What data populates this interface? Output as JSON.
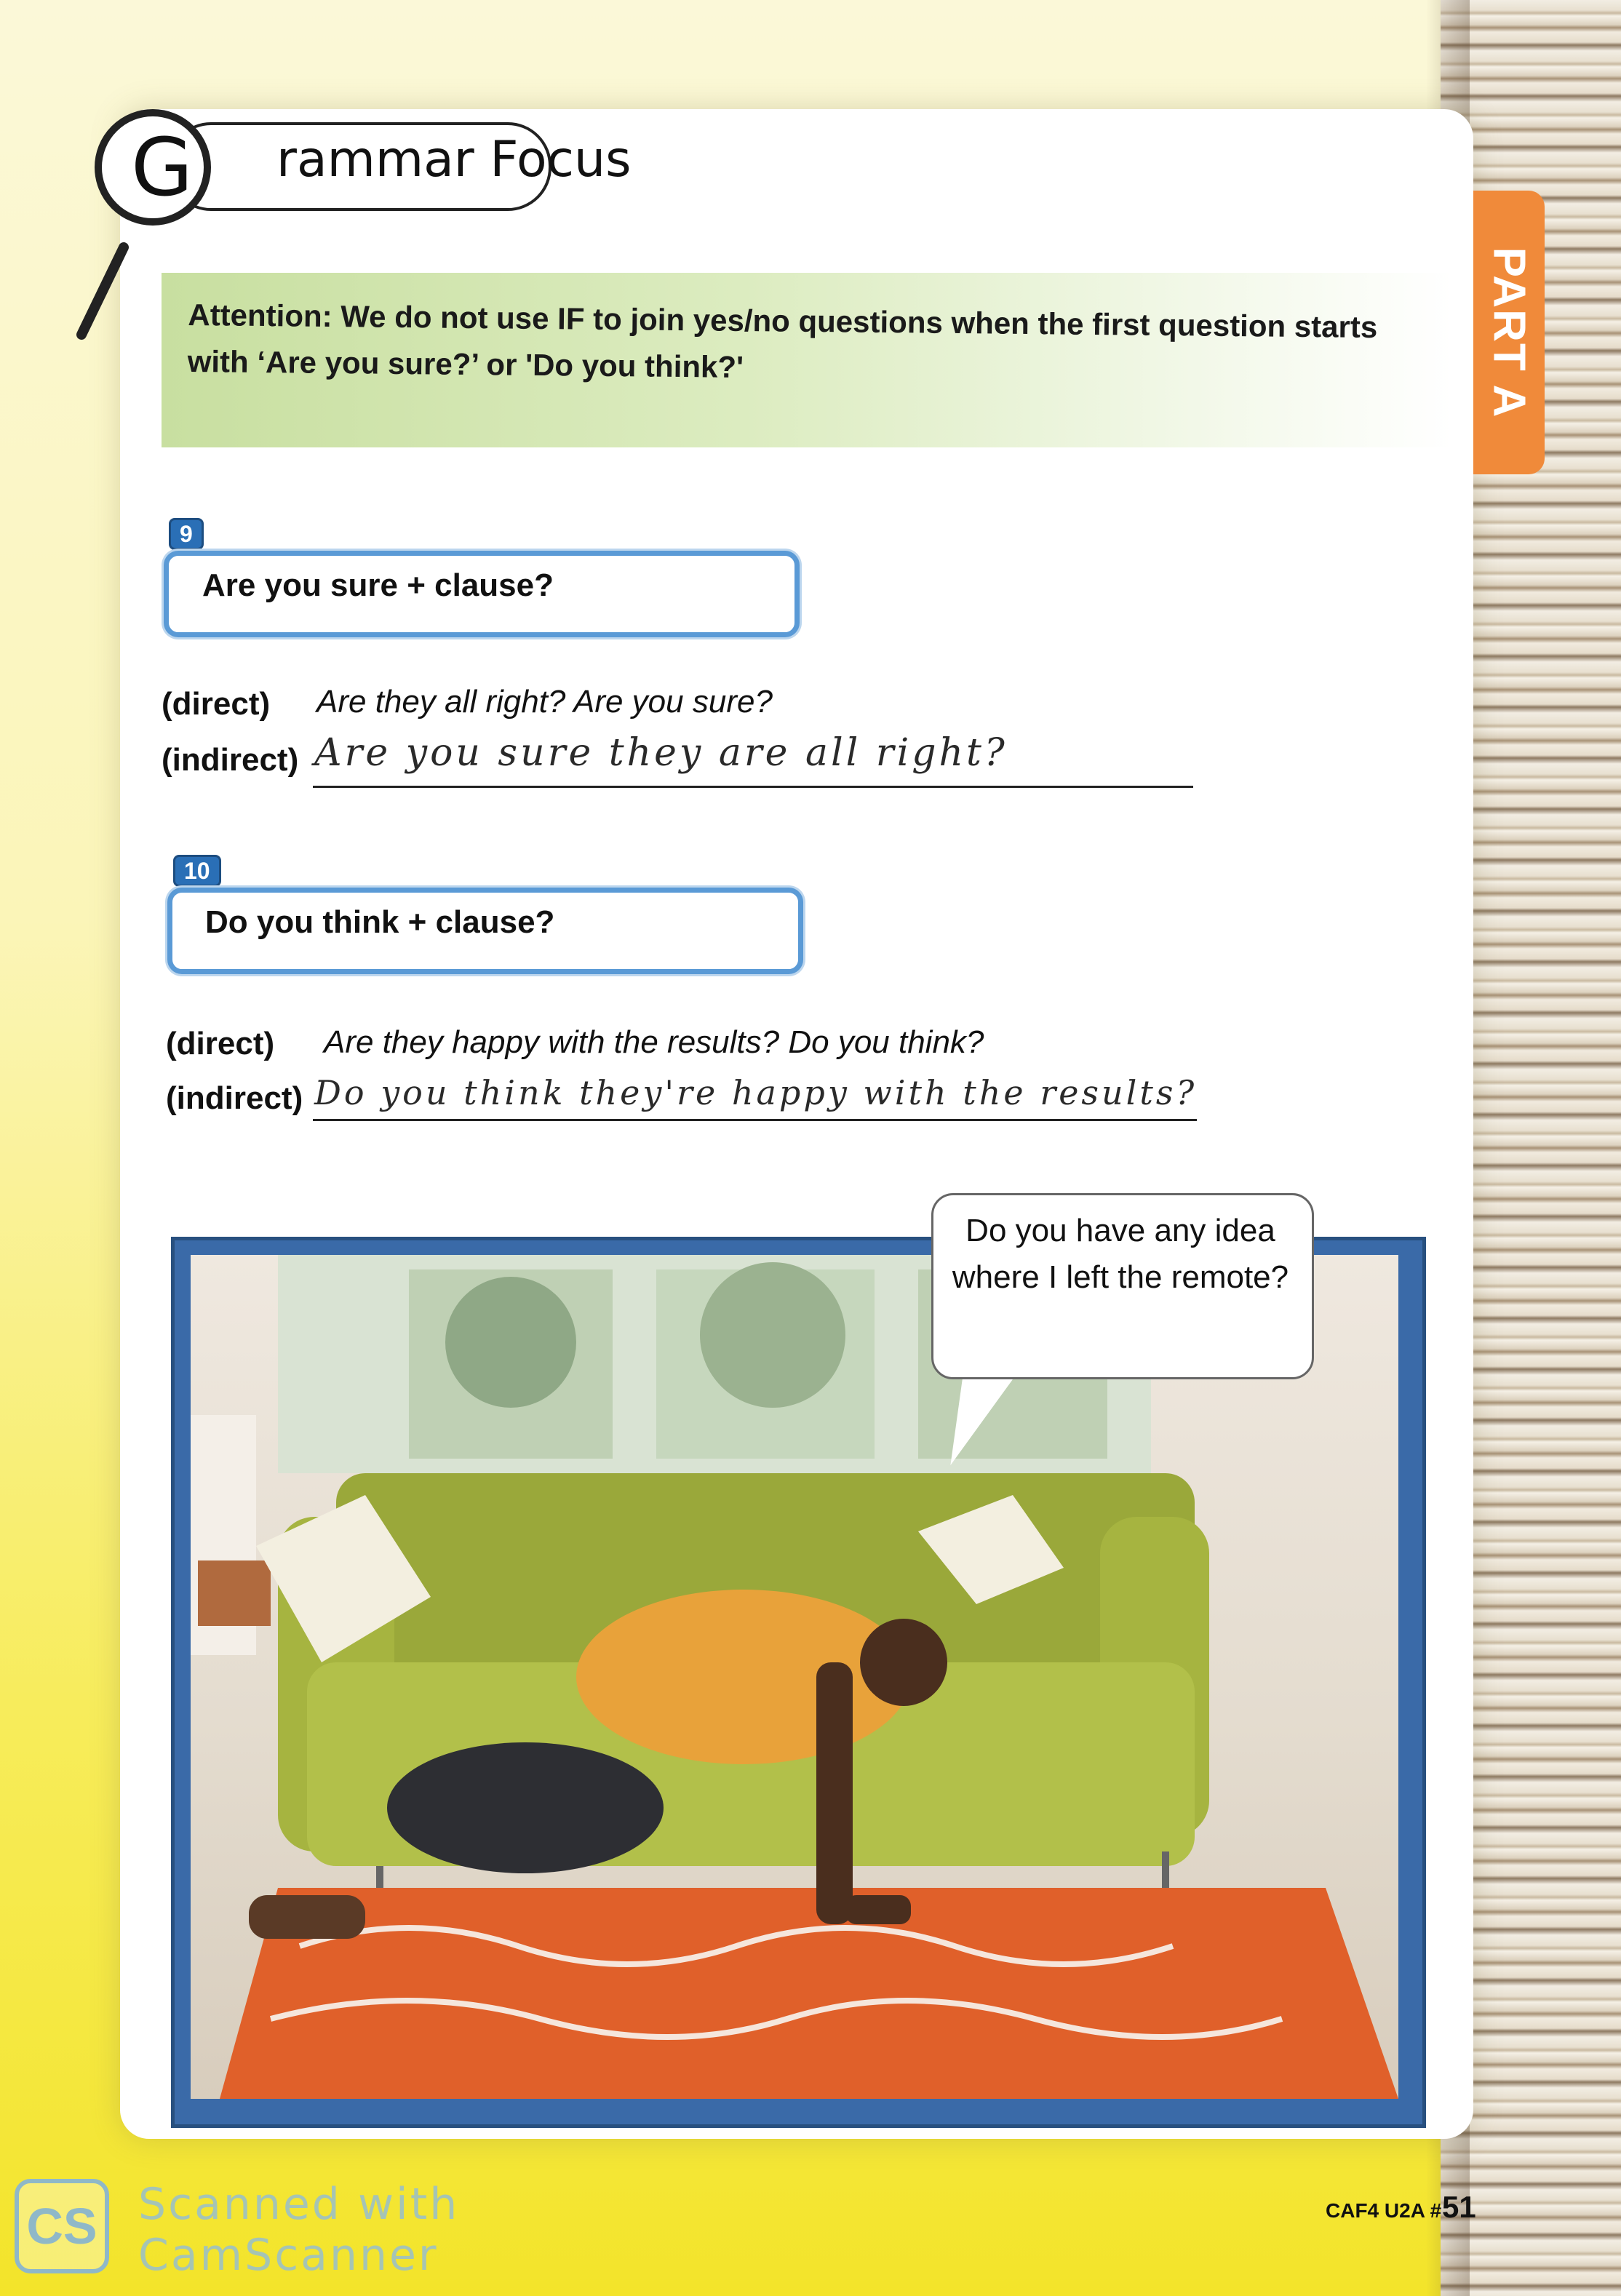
{
  "title": "Grammar Focus",
  "side_tab": "PART A",
  "attention": "Attention: We do not use IF to join yes/no questions when the first question starts with ‘Are you sure?’ or 'Do you think?'",
  "items": [
    {
      "number": "9",
      "rule": "Are you sure + clause?",
      "direct_label": "(direct)",
      "direct_question": "Are they all right? Are you sure?",
      "indirect_label": "(indirect)",
      "indirect_answer": "Are you sure they are all right?"
    },
    {
      "number": "10",
      "rule": "Do you think + clause?",
      "direct_label": "(direct)",
      "direct_question": "Are they happy with the results? Do you think?",
      "indirect_label": "(indirect)",
      "indirect_answer": "Do you think they're happy with the results?"
    }
  ],
  "speech_bubble": "Do you have any idea where I left the remote?",
  "footer": {
    "code": "CAF4 U2A #",
    "page_number": "51"
  },
  "watermark": {
    "logo": "CS",
    "line1": "Scanned with",
    "line2": "CamScanner"
  },
  "colors": {
    "part_tab": "#f08a3a",
    "rule_box_border": "#5a9ad6",
    "badge": "#2a6fb6",
    "banner": "#c8dfa0"
  }
}
